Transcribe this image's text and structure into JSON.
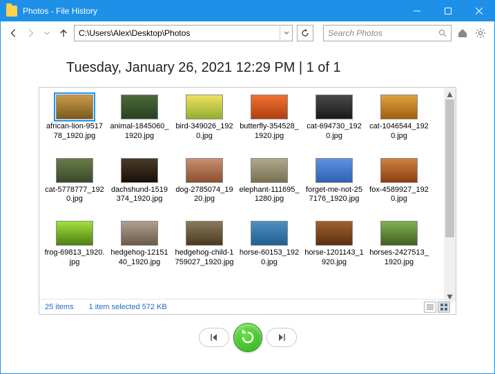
{
  "window": {
    "title": "Photos - File History"
  },
  "nav": {
    "path": "C:\\Users\\Alex\\Desktop\\Photos",
    "search_placeholder": "Search Photos"
  },
  "heading": "Tuesday, January 26, 2021 12:29 PM   |   1 of 1",
  "items": [
    {
      "name": "african-lion-951778_1920.jpg",
      "cls": "t-lion"
    },
    {
      "name": "animal-1845060_1920.jpg",
      "cls": "t-owl"
    },
    {
      "name": "bird-349026_1920.jpg",
      "cls": "t-bird"
    },
    {
      "name": "butterfly-354528_1920.jpg",
      "cls": "t-butterfly"
    },
    {
      "name": "cat-694730_1920.jpg",
      "cls": "t-cat1"
    },
    {
      "name": "cat-1046544_1920.jpg",
      "cls": "t-cat2"
    },
    {
      "name": "cat-5778777_1920.jpg",
      "cls": "t-cat3"
    },
    {
      "name": "dachshund-1519374_1920.jpg",
      "cls": "t-dachs"
    },
    {
      "name": "dog-2785074_1920.jpg",
      "cls": "t-dog"
    },
    {
      "name": "elephant-111695_1280.jpg",
      "cls": "t-eleph"
    },
    {
      "name": "forget-me-not-257176_1920.jpg",
      "cls": "t-forget"
    },
    {
      "name": "fox-4589927_1920.jpg",
      "cls": "t-fox"
    },
    {
      "name": "frog-69813_1920.jpg",
      "cls": "t-frog"
    },
    {
      "name": "hedgehog-1215140_1920.jpg",
      "cls": "t-hedge1"
    },
    {
      "name": "hedgehog-child-1759027_1920.jpg",
      "cls": "t-hedge2"
    },
    {
      "name": "horse-60153_1920.jpg",
      "cls": "t-horse1"
    },
    {
      "name": "horse-1201143_1920.jpg",
      "cls": "t-horse2"
    },
    {
      "name": "horses-2427513_1920.jpg",
      "cls": "t-horses"
    }
  ],
  "selected_index": 0,
  "status": {
    "count": "25 items",
    "selection": "1 item selected  572 KB"
  }
}
